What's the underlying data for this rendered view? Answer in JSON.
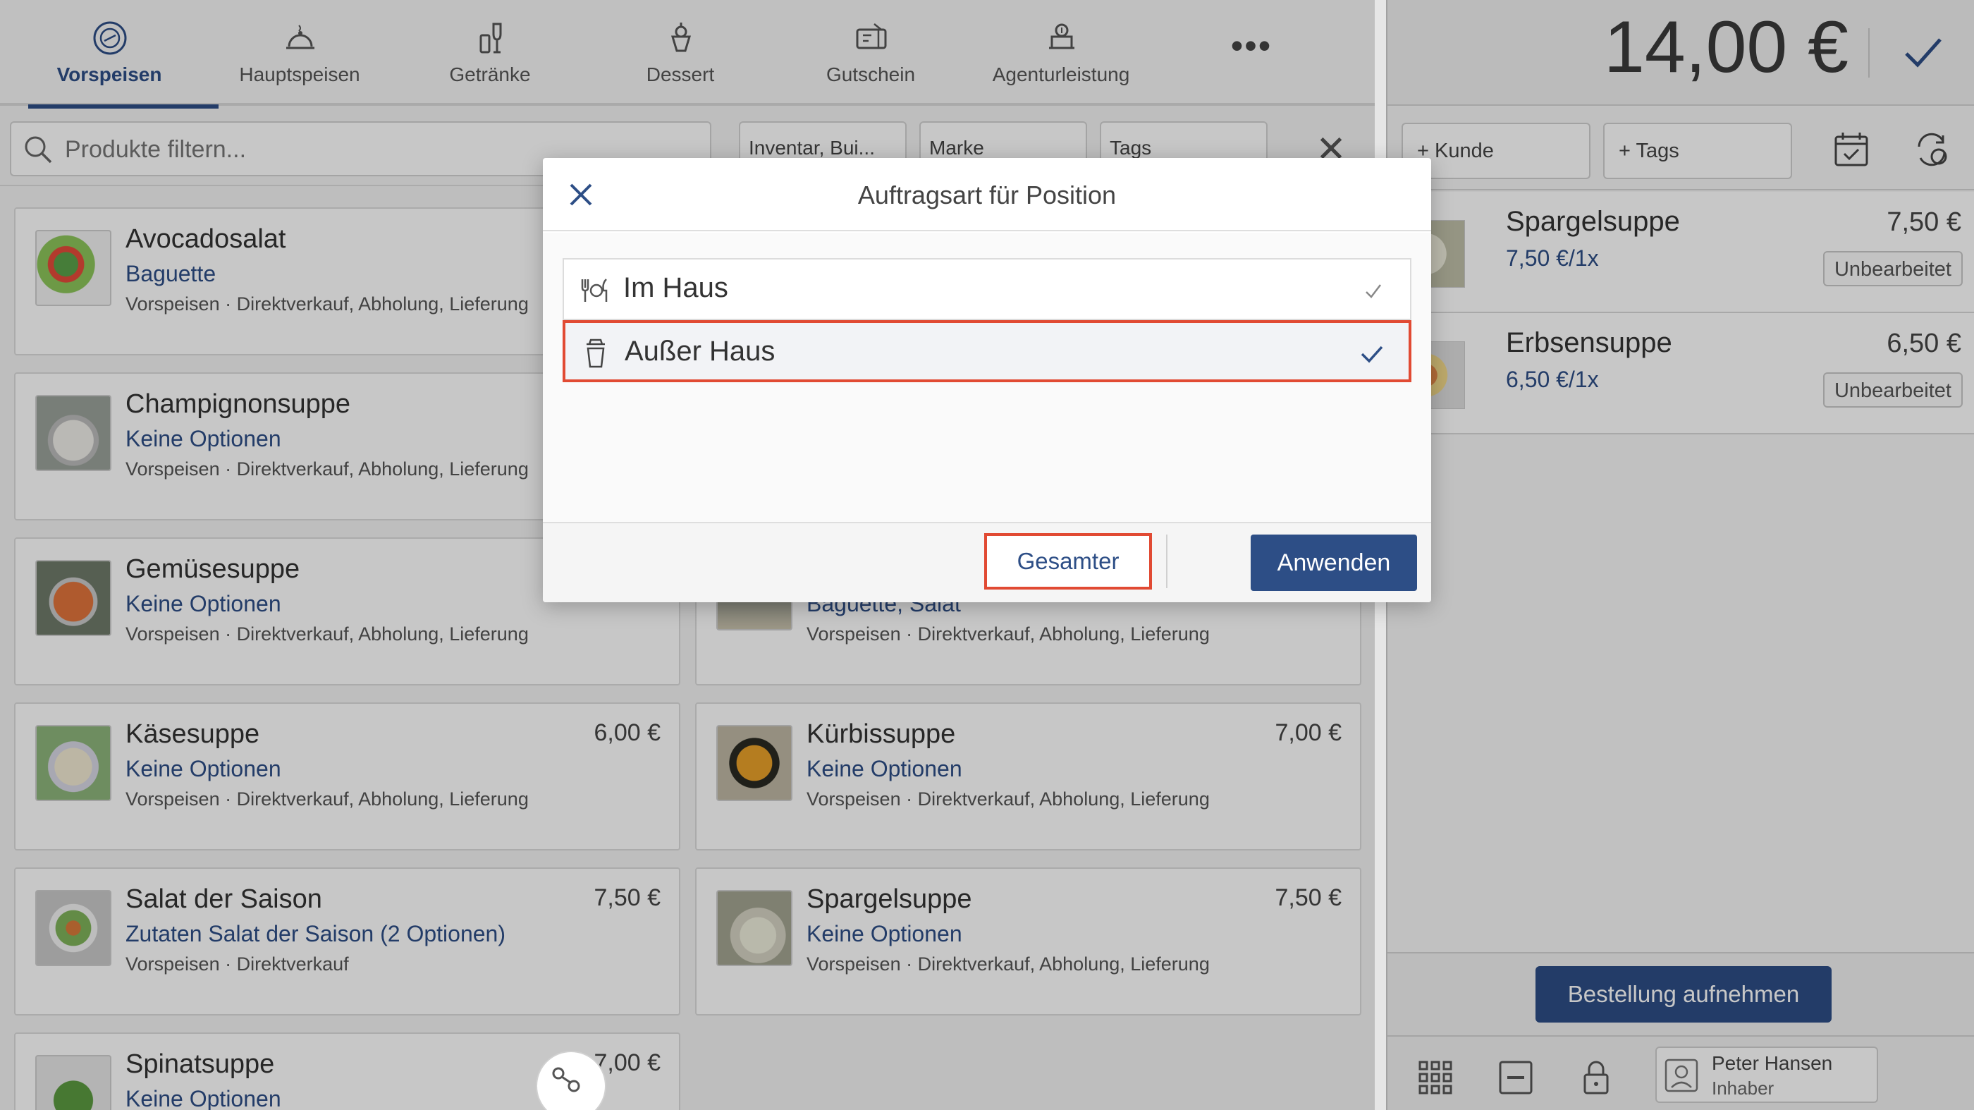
{
  "tabs": [
    {
      "label": "Vorspeisen",
      "icon": "starter-plate-icon",
      "active": true
    },
    {
      "label": "Hauptspeisen",
      "icon": "cloche-icon"
    },
    {
      "label": "Getränke",
      "icon": "drinks-icon"
    },
    {
      "label": "Dessert",
      "icon": "dessert-icon"
    },
    {
      "label": "Gutschein",
      "icon": "voucher-icon"
    },
    {
      "label": "Agenturleistung",
      "icon": "agency-service-icon"
    }
  ],
  "more_label": "•••",
  "filter": {
    "search_placeholder": "Produkte filtern...",
    "chips": [
      "Inventar, Bui...",
      "Marke",
      "Tags"
    ],
    "close": "✕"
  },
  "products": [
    {
      "name": "Avocadosalat",
      "option": "Baguette",
      "category": "Vorspeisen · Direktverkauf, Abholung, Lieferung",
      "price": ""
    },
    {
      "name": "Champignonsuppe",
      "option": "Keine Optionen",
      "category": "Vorspeisen · Direktverkauf, Abholung, Lieferung",
      "price": ""
    },
    {
      "name": "Gemüsesuppe",
      "option": "Keine Optionen",
      "category": "Vorspeisen · Direktverkauf, Abholung, Lieferung",
      "price": ""
    },
    {
      "name": "",
      "option": "Baguette, Salat",
      "category": "Vorspeisen · Direktverkauf, Abholung, Lieferung",
      "price": ""
    },
    {
      "name": "Käsesuppe",
      "option": "Keine Optionen",
      "category": "Vorspeisen · Direktverkauf, Abholung, Lieferung",
      "price": "6,00 €"
    },
    {
      "name": "Kürbissuppe",
      "option": "Keine Optionen",
      "category": "Vorspeisen · Direktverkauf, Abholung, Lieferung",
      "price": "7,00 €"
    },
    {
      "name": "Salat der Saison",
      "option": "Zutaten Salat der Saison (2 Optionen)",
      "category": "Vorspeisen · Direktverkauf",
      "price": "7,50 €"
    },
    {
      "name": "Spargelsuppe",
      "option": "Keine Optionen",
      "category": "Vorspeisen · Direktverkauf, Abholung, Lieferung",
      "price": "7,50 €"
    },
    {
      "name": "Spinatsuppe",
      "option": "Keine Optionen",
      "category": "",
      "price": "7,00 €"
    }
  ],
  "order": {
    "total": "14,00 €",
    "customer_button": "+  Kunde",
    "tags_button": "+  Tags",
    "lines": [
      {
        "name": "Spargelsuppe",
        "unit": "7,50 €/1x",
        "price": "7,50 €",
        "status": "Unbearbeitet"
      },
      {
        "name": "Erbsensuppe",
        "unit": "6,50 €/1x",
        "price": "6,50 €",
        "status": "Unbearbeitet"
      }
    ],
    "take_order_button": "Bestellung aufnehmen",
    "user": {
      "name": "Peter Hansen",
      "role": "Inhaber"
    }
  },
  "dialog": {
    "title": "Auftragsart für Position",
    "options": [
      {
        "label": "Im Haus",
        "icon": "cutlery-icon",
        "selected": false
      },
      {
        "label": "Außer Haus",
        "icon": "takeaway-cup-icon",
        "selected": true
      }
    ],
    "whole_order_button": "Gesamter Auftrag",
    "apply_button": "Anwenden"
  },
  "colors": {
    "accent": "#2d4e86",
    "highlight": "#e14a33"
  }
}
